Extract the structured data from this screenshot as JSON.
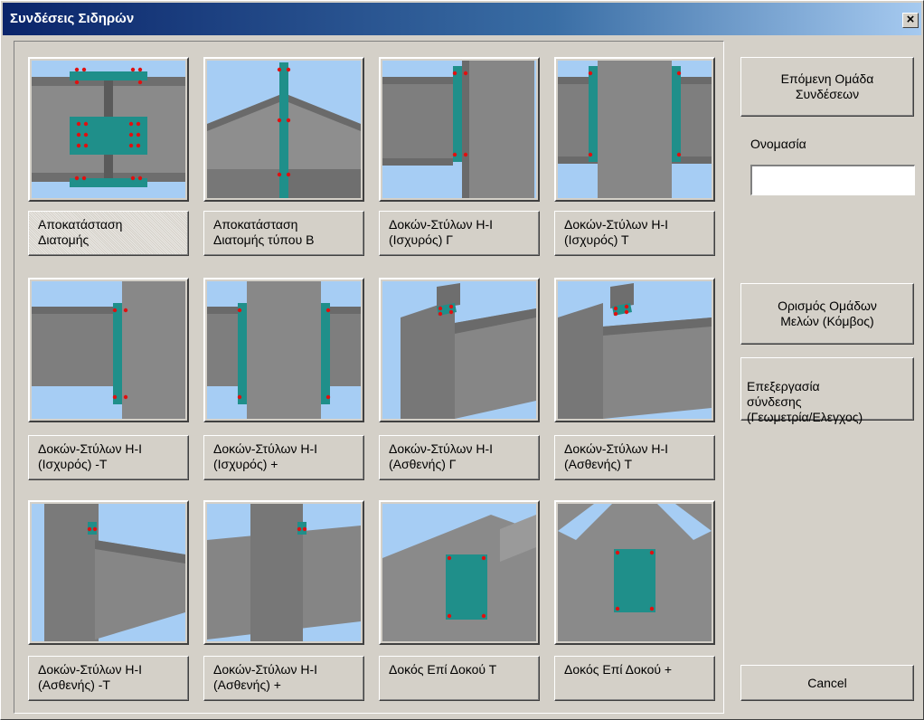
{
  "window": {
    "title": "Συνδέσεις Σιδηρών",
    "close_glyph": "×"
  },
  "connections": [
    {
      "label": "Αποκατάσταση\nΔιατομής",
      "icon": "splice-icon",
      "selected": true
    },
    {
      "label": "Αποκατάσταση\nΔιατομής τύπου Β",
      "icon": "splice-b-icon"
    },
    {
      "label": "Δοκών-Στύλων Η-Ι\n(Ισχυρός) Γ",
      "icon": "beam-column-strong-l-icon"
    },
    {
      "label": "Δοκών-Στύλων Η-Ι\n(Ισχυρός) Τ",
      "icon": "beam-column-strong-t-icon"
    },
    {
      "label": "Δοκών-Στύλων Η-Ι\n(Ισχυρός) -Τ",
      "icon": "beam-column-strong-minus-t-icon"
    },
    {
      "label": "Δοκών-Στύλων Η-Ι\n(Ισχυρός) +",
      "icon": "beam-column-strong-plus-icon"
    },
    {
      "label": "Δοκών-Στύλων Η-Ι\n(Ασθενής) Γ",
      "icon": "beam-column-weak-l-icon"
    },
    {
      "label": "Δοκών-Στύλων Η-Ι\n(Ασθενής) Τ",
      "icon": "beam-column-weak-t-icon"
    },
    {
      "label": "Δοκών-Στύλων Η-Ι\n(Ασθενής) -Τ",
      "icon": "beam-column-weak-minus-t-icon"
    },
    {
      "label": "Δοκών-Στύλων Η-Ι\n(Ασθενής) +",
      "icon": "beam-column-weak-plus-icon"
    },
    {
      "label": "Δοκός Επί Δοκού Τ",
      "icon": "beam-on-beam-t-icon"
    },
    {
      "label": "Δοκός Επί Δοκού +",
      "icon": "beam-on-beam-plus-icon"
    }
  ],
  "side": {
    "next_group_label": "Επόμενη Ομάδα\nΣυνδέσεων",
    "name_label": "Ονομασία",
    "name_value": "",
    "define_groups_label": "Ορισμός Ομάδων\nΜελών (Κόμβος)",
    "edit_connection_label": "Επεξεργασία\nσύνδεσης\n(Γεωμετρία/Ελεγχος)",
    "cancel_label": "Cancel"
  },
  "colors": {
    "sky": "#a6cdf4",
    "steel": "#7c7c7c",
    "plate": "#1f8f8a",
    "bolt": "#e01010",
    "title_start": "#0a246a",
    "title_end": "#a6caf0"
  }
}
